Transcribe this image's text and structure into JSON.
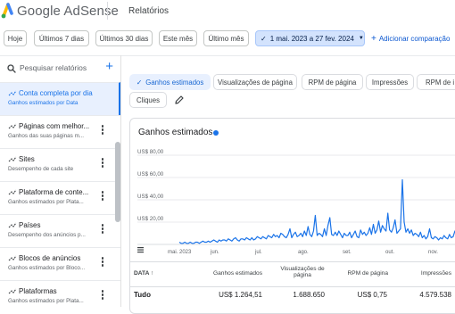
{
  "app": {
    "brand": "Google AdSense",
    "page_title": "Relatórios"
  },
  "filters": {
    "presets": [
      "Hoje",
      "Últimos 7 dias",
      "Últimos 30 dias",
      "Este mês",
      "Último mês"
    ],
    "date_range": "1 mai. 2023 a 27 fev. 2024",
    "add_comparison": "Adicionar comparação"
  },
  "sidebar": {
    "search_placeholder": "Pesquisar relatórios",
    "items": [
      {
        "title": "Conta completa por dia",
        "subtitle": "Ganhos estimados por Data"
      },
      {
        "title": "Páginas com melhor...",
        "subtitle": "Ganhos das suas páginas m..."
      },
      {
        "title": "Sites",
        "subtitle": "Desempenho de cada site"
      },
      {
        "title": "Plataforma de conte...",
        "subtitle": "Ganhos estimados por Plata..."
      },
      {
        "title": "Países",
        "subtitle": "Desempenho dos anúncios p..."
      },
      {
        "title": "Blocos de anúncios",
        "subtitle": "Ganhos estimados por Bloco..."
      },
      {
        "title": "Plataformas",
        "subtitle": "Ganhos estimados por Plata..."
      }
    ]
  },
  "metrics": [
    "Ganhos estimados",
    "Visualizações de página",
    "RPM de página",
    "Impressões",
    "RPM de i",
    "Cliques"
  ],
  "chart": {
    "title": "Ganhos estimados",
    "series_color": "#1a73e8"
  },
  "chart_data": {
    "type": "line",
    "title": "Ganhos estimados",
    "yticks": [
      "US$ 80,00",
      "US$ 60,00",
      "US$ 40,00",
      "US$ 20,00"
    ],
    "ylim": [
      0,
      80
    ],
    "xticks": [
      "mai. 2023",
      "jun.",
      "jul.",
      "ago.",
      "set.",
      "out.",
      "nov."
    ],
    "grid": true,
    "series": [
      {
        "values": [
          2,
          1,
          1,
          2,
          1,
          1,
          2,
          1,
          1,
          2,
          2,
          1,
          2,
          3,
          2,
          2,
          3,
          2,
          3,
          4,
          3,
          2,
          4,
          3,
          4,
          4,
          3,
          5,
          4,
          3,
          5,
          6,
          4,
          3,
          5,
          5,
          4,
          6,
          5,
          4,
          6,
          4,
          5,
          7,
          6,
          5,
          7,
          6,
          5,
          8,
          7,
          6,
          9,
          7,
          8,
          6,
          10,
          9,
          7,
          6,
          9,
          14,
          6,
          9,
          11,
          7,
          8,
          10,
          7,
          12,
          8,
          16,
          9,
          7,
          12,
          26,
          8,
          10,
          9,
          7,
          14,
          8,
          17,
          24,
          9,
          8,
          11,
          8,
          12,
          9,
          6,
          10,
          8,
          8,
          11,
          6,
          9,
          12,
          7,
          6,
          13,
          9,
          11,
          8,
          10,
          15,
          9,
          18,
          10,
          13,
          21,
          11,
          17,
          14,
          12,
          28,
          13,
          11,
          15,
          22,
          10,
          12,
          14,
          58,
          20,
          11,
          14,
          10,
          13,
          8,
          10,
          9,
          7,
          11,
          6,
          8,
          5,
          7,
          14,
          6,
          5,
          7,
          6,
          4,
          6,
          5,
          8,
          6,
          5,
          9,
          6,
          7,
          12,
          7,
          5,
          6
        ]
      }
    ]
  },
  "table": {
    "headers": [
      "DATA",
      "Ganhos estimados",
      "Visualizações de página",
      "RPM de página",
      "Impressões"
    ],
    "total_row": [
      "Tudo",
      "US$ 1.264,51",
      "1.688.650",
      "US$ 0,75",
      "4.579.538"
    ]
  }
}
